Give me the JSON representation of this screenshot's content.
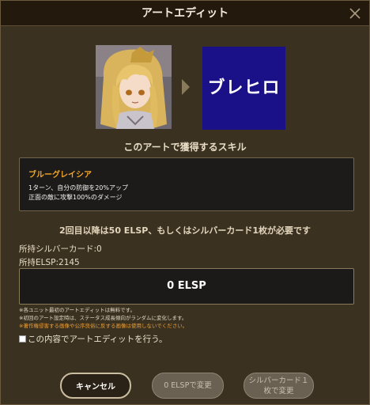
{
  "dialog": {
    "title": "アートエディット",
    "close_icon": "close-icon"
  },
  "art": {
    "preview_text": "ブレヒロ",
    "preview_bg": "#1a1088"
  },
  "skill": {
    "heading": "このアートで獲得するスキル",
    "name": "ブルーグレイシア",
    "desc_line1": "1ターン、自分の防御を20%アップ",
    "desc_line2": "正面の敵に攻撃100%のダメージ"
  },
  "requirement": "2回目以降は50 ELSP、もしくはシルバーカード1枚が必要です",
  "stats": {
    "silver": "所持シルバーカード:0",
    "elsp": "所持ELSP:2145"
  },
  "cost": "0 ELSP",
  "notes": {
    "n1": "※各ユニット最初のアートエディットは無料です。",
    "n2": "※初回のアート設定時は、ステータス成長傾向がランダムに変化します。",
    "n3": "※著作権侵害する画像や公序良俗に反する画像は使用しないでください。"
  },
  "confirm_label": "この内容でアートエディットを行う。",
  "buttons": {
    "cancel": "キャンセル",
    "elsp_change": "0 ELSPで変更",
    "silver_line1": "シルバーカード１",
    "silver_line2": "枚で変更"
  },
  "colors": {
    "accent_orange": "#f5a623",
    "warning_orange": "#f0a030"
  }
}
